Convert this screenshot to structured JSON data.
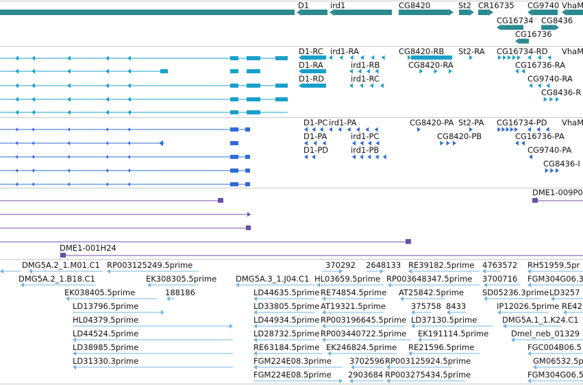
{
  "colors": {
    "gene": "#2b8a8f",
    "transcript": "#1aa0c8",
    "cds": "#2f6bd6",
    "purple": "#6c4fa8",
    "est": "#74b4e0",
    "divider": "#c8c8c8"
  },
  "tracks": {
    "genes": {
      "labels": [
        "D1",
        "ird1",
        "CG8420",
        "St2",
        "CR16735",
        "CG9740",
        "VhaM",
        "CG16734",
        "CG8436",
        "CG16736"
      ]
    },
    "transcripts": {
      "labels": [
        "D1-RC",
        "ird1-RA",
        "CG8420-RB",
        "St2-RA",
        "CG16734-RD",
        "VhaM",
        "D1-RA",
        "ird1-RB",
        "CG8420-RA",
        "CG16736-RA",
        "D1-RD",
        "ird1-RC",
        "CG9740-RA",
        "CG8436-R"
      ]
    },
    "proteins": {
      "labels": [
        "D1-PC",
        "ird1-PA",
        "CG8420-PA",
        "St2-PA",
        "CG16734-PD",
        "VhaM",
        "D1-PA",
        "ird1-PC",
        "CG8420-PB",
        "CG16736-PA",
        "D1-PD",
        "ird1-PB",
        "CG9740-PA",
        "CG8436-I"
      ]
    },
    "purple": {
      "labels": [
        "DME1-009P0",
        "DME1-001H24"
      ]
    },
    "ests": {
      "labels": [
        "DMG5A.2_1.M01.C1",
        "RP003125249.5prime",
        "370292",
        "2648133",
        "RE39182.5prime",
        "4763572",
        "RH51959.5pr",
        "DMG5A.2_1.B18.C1",
        "EK308305.5prime",
        "DMG5A.3_1.J04.C1",
        "HL03659.5prime",
        "RP003648347.5prime",
        "3700716",
        "FGM304G06.3",
        "EK038405.5prime",
        "188186",
        "LD44635.5prime",
        "RE74854.5prime",
        "AT25842.5prime",
        "SD05236.3prime",
        "LD3257",
        "LD13796.5prime",
        "LD33805.5prime",
        "AT19321.5prime",
        "375758",
        "8433",
        "IP12026.5prime",
        "RE42",
        "HL04379.5prime",
        "LD44934.5prime",
        "RP003196645.5prime",
        "LD37130.5prime",
        "DMG5A.1_1.K24.C1",
        "LD44524.5prime",
        "LD28732.5prime",
        "RP003440722.5prime",
        "EK191114.5prime",
        "Dmel_neb_01329",
        "LD38985.5prime",
        "RE63184.5prime",
        "EK246824.5prime",
        "RE21596.5prime",
        "FGC004B06.5",
        "LD31330.3prime",
        "FGM224E08.3prime",
        "3702596",
        "RP003125924.5prime",
        "GM06532.5p",
        "FGM224E08.5prime",
        "2903684",
        "RP003275434.5prime",
        "FGM304G06.5"
      ]
    }
  }
}
